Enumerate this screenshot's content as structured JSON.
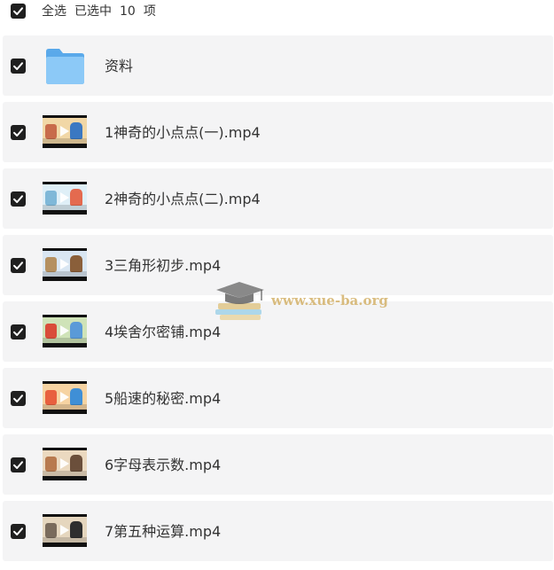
{
  "header": {
    "select_all_label": "全选",
    "selected_prefix": "已选中",
    "selected_count": "10",
    "selected_suffix": "项"
  },
  "files": [
    {
      "name": "资料",
      "type": "folder",
      "icon": "folder-icon",
      "checked": true
    },
    {
      "name": "1神奇的小点点(一).mp4",
      "type": "video",
      "icon": "video-thumbnail",
      "checked": true
    },
    {
      "name": "2神奇的小点点(二).mp4",
      "type": "video",
      "icon": "video-thumbnail",
      "checked": true
    },
    {
      "name": "3三角形初步.mp4",
      "type": "video",
      "icon": "video-thumbnail",
      "checked": true
    },
    {
      "name": "4埃舍尔密铺.mp4",
      "type": "video",
      "icon": "video-thumbnail",
      "checked": true
    },
    {
      "name": "5船速的秘密.mp4",
      "type": "video",
      "icon": "video-thumbnail",
      "checked": true
    },
    {
      "name": "6字母表示数.mp4",
      "type": "video",
      "icon": "video-thumbnail",
      "checked": true
    },
    {
      "name": "7第五种运算.mp4",
      "type": "video",
      "icon": "video-thumbnail",
      "checked": true
    }
  ],
  "watermark": {
    "text": "www.xue-ba.org",
    "icon": "graduation-cap-books-icon"
  },
  "colors": {
    "checkbox": "#1f1f1f",
    "row_background": "#f4f4f5",
    "folder_blue": "#6db8f0",
    "text": "#333333",
    "watermark": "#cfaa5c"
  }
}
